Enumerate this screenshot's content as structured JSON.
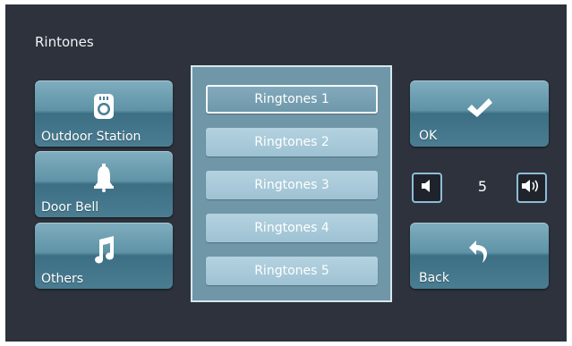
{
  "title": "Rintones",
  "categories": [
    {
      "label": "Outdoor Station",
      "icon": "outdoor-station-icon"
    },
    {
      "label": "Door Bell",
      "icon": "bell-icon"
    },
    {
      "label": "Others",
      "icon": "music-note-icon"
    }
  ],
  "ringtones": [
    {
      "label": "Ringtones 1",
      "selected": true
    },
    {
      "label": "Ringtones 2",
      "selected": false
    },
    {
      "label": "Ringtones 3",
      "selected": false
    },
    {
      "label": "Ringtones 4",
      "selected": false
    },
    {
      "label": "Ringtones 5",
      "selected": false
    }
  ],
  "volume": {
    "value": "5",
    "down_icon": "volume-down-icon",
    "up_icon": "volume-up-icon"
  },
  "actions": {
    "ok_label": "OK",
    "ok_icon": "checkmark-icon",
    "back_label": "Back",
    "back_icon": "back-arrow-icon"
  },
  "colors": {
    "screen_bg": "#2d323c",
    "button_accent": "#5f93a6",
    "list_panel_bg": "#6f97a8",
    "list_item_bg": "#a9cadb",
    "volume_border": "#8fbcd8"
  }
}
